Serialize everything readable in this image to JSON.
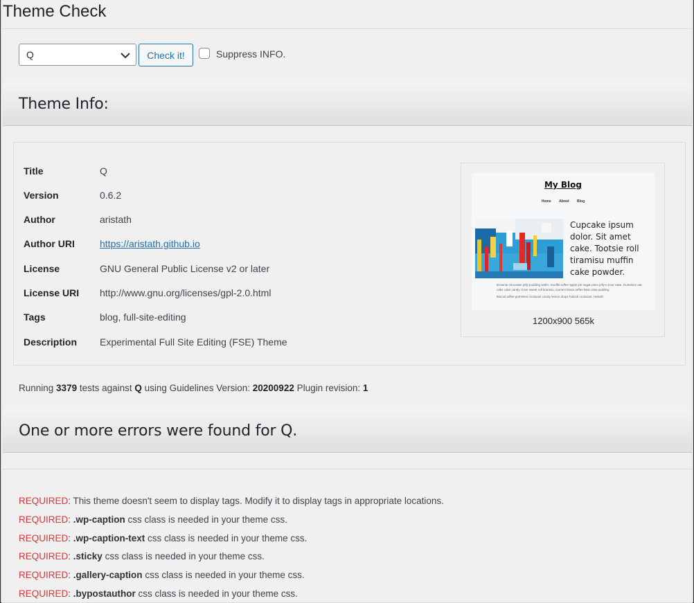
{
  "page": {
    "title": "Theme Check"
  },
  "controls": {
    "theme_select_value": "Q",
    "check_button": "Check it!",
    "suppress_label": "Suppress INFO.",
    "suppress_checked": false
  },
  "theme_info": {
    "heading": "Theme Info:",
    "rows": [
      {
        "label": "Title",
        "value": "Q"
      },
      {
        "label": "Version",
        "value": "0.6.2"
      },
      {
        "label": "Author",
        "value": "aristath"
      },
      {
        "label": "Author URI",
        "value": "https://aristath.github.io"
      },
      {
        "label": "License",
        "value": "GNU General Public License v2 or later"
      },
      {
        "label": "License URI",
        "value": "http://www.gnu.org/licenses/gpl-2.0.html"
      },
      {
        "label": "Tags",
        "value": "blog, full-site-editing"
      },
      {
        "label": "Description",
        "value": "Experimental Full Site Editing (FSE) Theme"
      }
    ],
    "screenshot": {
      "blog_title": "My Blog",
      "nav": [
        "Home",
        "About",
        "Blog"
      ],
      "text": "Cupcake ipsum dolor. Sit amet cake. Tootsie roll tiramisu muffin cake powder.",
      "small_text_1": "Brownie chocolate jelly pudding wafer. Soufflé toffee apple pie sugar plum jelly-o love cake. Gummies oat cake cake candy I love sweet roll tiramisu. Gummi bears toffee bear claw pudding.",
      "small_text_2": "Biscuit toffee gummies croissant candy lemon drops halvah croissant. Halvah",
      "caption": "1200x900 565k"
    }
  },
  "running": {
    "p1": "Running ",
    "tests": "3379",
    "p2": " tests against ",
    "theme": "Q",
    "p3": " using Guidelines Version: ",
    "guidelines": "20200922",
    "p4": " Plugin revision: ",
    "revision": "1"
  },
  "errors": {
    "heading": "One or more errors were found for Q.",
    "items": [
      {
        "tag": "REQUIRED",
        "bold": "",
        "text": ": This theme doesn't seem to display tags. Modify it to display tags in appropriate locations."
      },
      {
        "tag": "REQUIRED",
        "bold": ".wp-caption",
        "text": " css class is needed in your theme css."
      },
      {
        "tag": "REQUIRED",
        "bold": ".wp-caption-text",
        "text": " css class is needed in your theme css."
      },
      {
        "tag": "REQUIRED",
        "bold": ".sticky",
        "text": " css class is needed in your theme css."
      },
      {
        "tag": "REQUIRED",
        "bold": ".gallery-caption",
        "text": " css class is needed in your theme css."
      },
      {
        "tag": "REQUIRED",
        "bold": ".bypostauthor",
        "text": " css class is needed in your theme css."
      }
    ]
  },
  "colors": {
    "required": "#d63638",
    "link": "#2271b1",
    "text": "#3c434a",
    "background": "#f0f0f1"
  }
}
